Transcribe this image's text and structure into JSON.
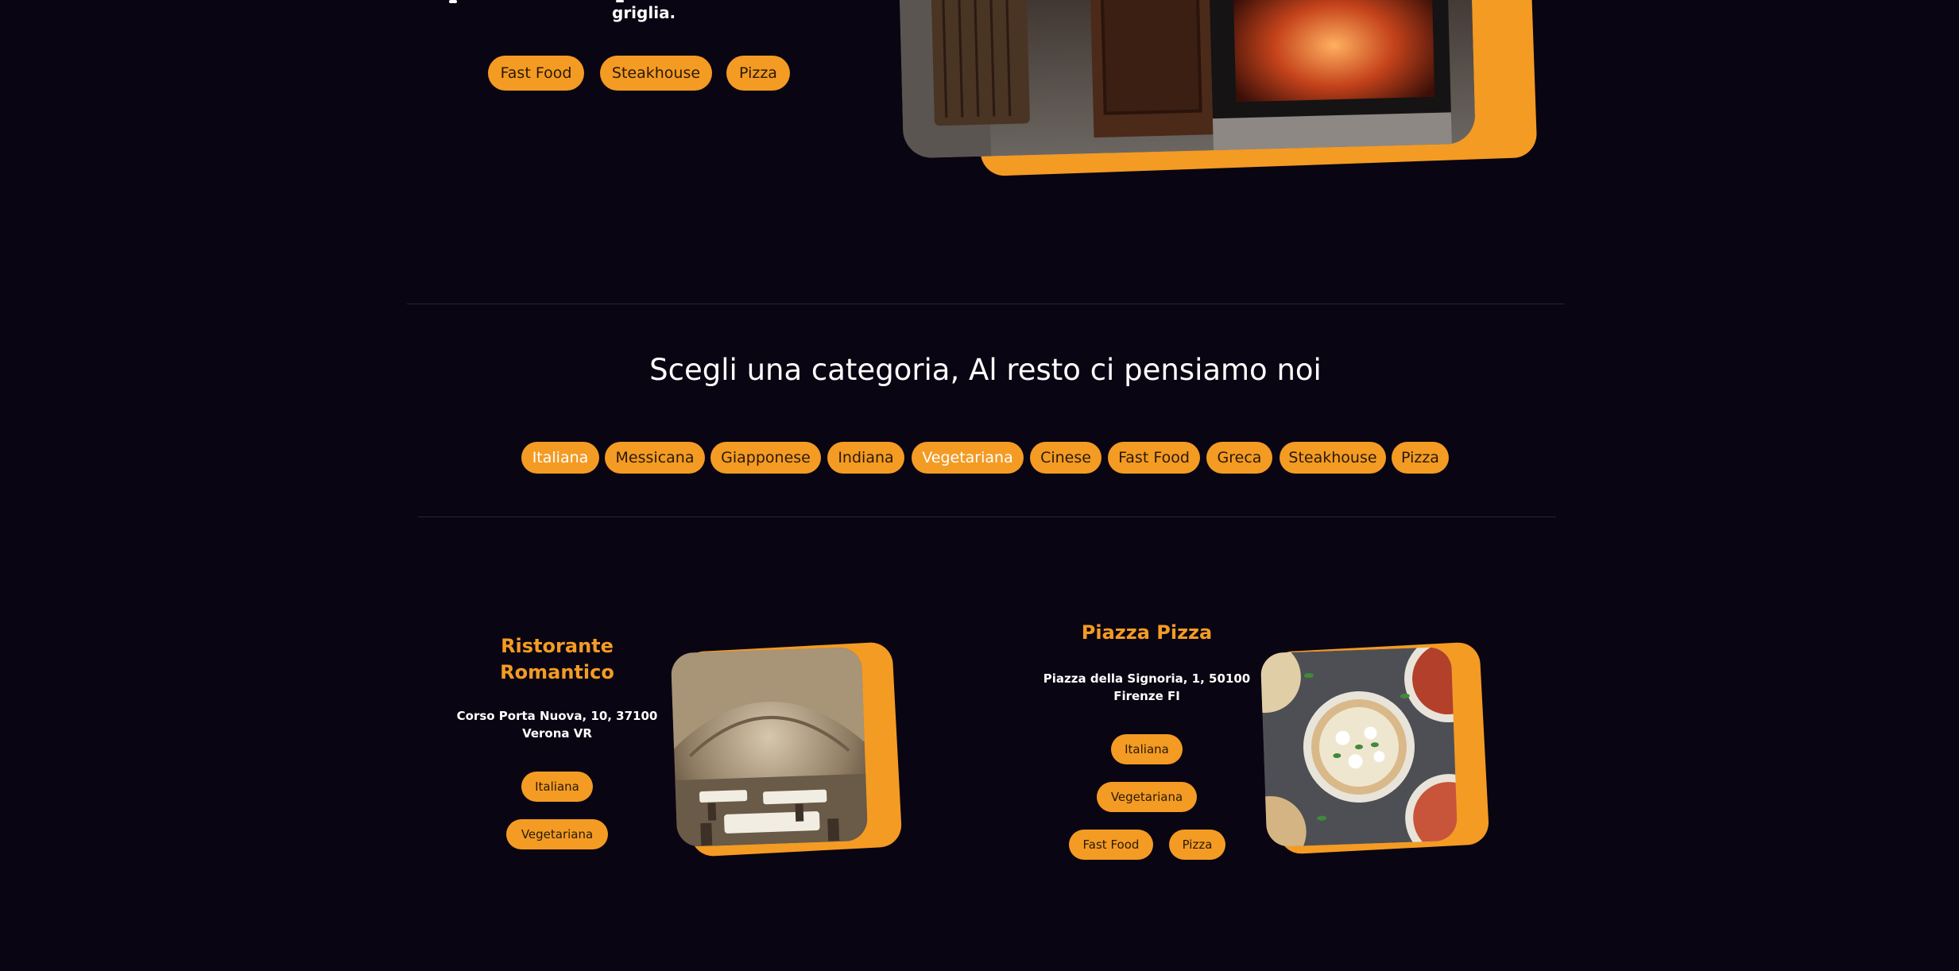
{
  "colors": {
    "background": "#0a0512",
    "accent": "#f49b24",
    "divider": "#2a2434",
    "pill_text": "#2a1a05",
    "heading_accent": "#f49b24"
  },
  "hero": {
    "desc_tail": "griglia.",
    "tags": [
      "Fast Food",
      "Steakhouse",
      "Pizza"
    ],
    "image_alt": "steakhouse-interior-photo"
  },
  "categories": {
    "title": "Scegli una categoria, Al resto ci pensiamo noi",
    "items": [
      "Italiana",
      "Messicana",
      "Giapponese",
      "Indiana",
      "Vegetariana",
      "Cinese",
      "Fast Food",
      "Greca",
      "Steakhouse",
      "Pizza"
    ],
    "active": [
      "Italiana",
      "Vegetariana"
    ]
  },
  "restaurants": [
    {
      "name_line1": "Ristorante",
      "name_line2": "Romantico",
      "address_line1": "Corso Porta Nuova, 10, 37100",
      "address_line2": "Verona VR",
      "tags": [
        "Italiana",
        "Vegetariana"
      ],
      "image": "vaulted-dining-room-photo"
    },
    {
      "name_line1": "Piazza Pizza",
      "address_line1": "Piazza della Signoria, 1, 50100",
      "address_line2": "Firenze FI",
      "tags": [
        "Italiana",
        "Vegetariana",
        "Fast Food",
        "Pizza"
      ],
      "image": "pizzas-overhead-photo"
    }
  ]
}
